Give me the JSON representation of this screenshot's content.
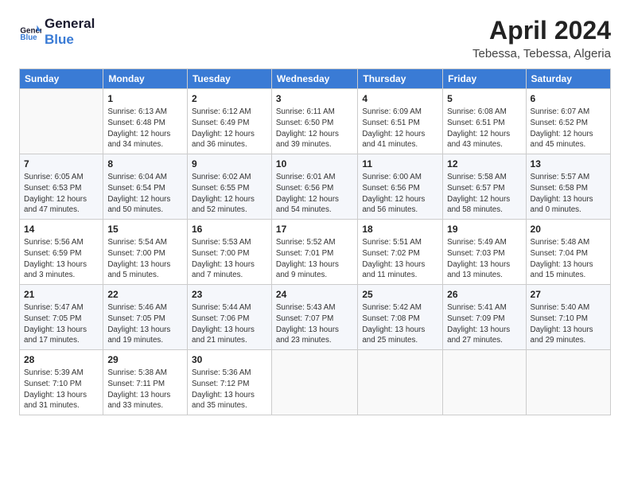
{
  "logo": {
    "line1": "General",
    "line2": "Blue"
  },
  "title": "April 2024",
  "subtitle": "Tebessa, Tebessa, Algeria",
  "days_header": [
    "Sunday",
    "Monday",
    "Tuesday",
    "Wednesday",
    "Thursday",
    "Friday",
    "Saturday"
  ],
  "weeks": [
    [
      {
        "day": "",
        "info": ""
      },
      {
        "day": "1",
        "info": "Sunrise: 6:13 AM\nSunset: 6:48 PM\nDaylight: 12 hours\nand 34 minutes."
      },
      {
        "day": "2",
        "info": "Sunrise: 6:12 AM\nSunset: 6:49 PM\nDaylight: 12 hours\nand 36 minutes."
      },
      {
        "day": "3",
        "info": "Sunrise: 6:11 AM\nSunset: 6:50 PM\nDaylight: 12 hours\nand 39 minutes."
      },
      {
        "day": "4",
        "info": "Sunrise: 6:09 AM\nSunset: 6:51 PM\nDaylight: 12 hours\nand 41 minutes."
      },
      {
        "day": "5",
        "info": "Sunrise: 6:08 AM\nSunset: 6:51 PM\nDaylight: 12 hours\nand 43 minutes."
      },
      {
        "day": "6",
        "info": "Sunrise: 6:07 AM\nSunset: 6:52 PM\nDaylight: 12 hours\nand 45 minutes."
      }
    ],
    [
      {
        "day": "7",
        "info": "Sunrise: 6:05 AM\nSunset: 6:53 PM\nDaylight: 12 hours\nand 47 minutes."
      },
      {
        "day": "8",
        "info": "Sunrise: 6:04 AM\nSunset: 6:54 PM\nDaylight: 12 hours\nand 50 minutes."
      },
      {
        "day": "9",
        "info": "Sunrise: 6:02 AM\nSunset: 6:55 PM\nDaylight: 12 hours\nand 52 minutes."
      },
      {
        "day": "10",
        "info": "Sunrise: 6:01 AM\nSunset: 6:56 PM\nDaylight: 12 hours\nand 54 minutes."
      },
      {
        "day": "11",
        "info": "Sunrise: 6:00 AM\nSunset: 6:56 PM\nDaylight: 12 hours\nand 56 minutes."
      },
      {
        "day": "12",
        "info": "Sunrise: 5:58 AM\nSunset: 6:57 PM\nDaylight: 12 hours\nand 58 minutes."
      },
      {
        "day": "13",
        "info": "Sunrise: 5:57 AM\nSunset: 6:58 PM\nDaylight: 13 hours\nand 0 minutes."
      }
    ],
    [
      {
        "day": "14",
        "info": "Sunrise: 5:56 AM\nSunset: 6:59 PM\nDaylight: 13 hours\nand 3 minutes."
      },
      {
        "day": "15",
        "info": "Sunrise: 5:54 AM\nSunset: 7:00 PM\nDaylight: 13 hours\nand 5 minutes."
      },
      {
        "day": "16",
        "info": "Sunrise: 5:53 AM\nSunset: 7:00 PM\nDaylight: 13 hours\nand 7 minutes."
      },
      {
        "day": "17",
        "info": "Sunrise: 5:52 AM\nSunset: 7:01 PM\nDaylight: 13 hours\nand 9 minutes."
      },
      {
        "day": "18",
        "info": "Sunrise: 5:51 AM\nSunset: 7:02 PM\nDaylight: 13 hours\nand 11 minutes."
      },
      {
        "day": "19",
        "info": "Sunrise: 5:49 AM\nSunset: 7:03 PM\nDaylight: 13 hours\nand 13 minutes."
      },
      {
        "day": "20",
        "info": "Sunrise: 5:48 AM\nSunset: 7:04 PM\nDaylight: 13 hours\nand 15 minutes."
      }
    ],
    [
      {
        "day": "21",
        "info": "Sunrise: 5:47 AM\nSunset: 7:05 PM\nDaylight: 13 hours\nand 17 minutes."
      },
      {
        "day": "22",
        "info": "Sunrise: 5:46 AM\nSunset: 7:05 PM\nDaylight: 13 hours\nand 19 minutes."
      },
      {
        "day": "23",
        "info": "Sunrise: 5:44 AM\nSunset: 7:06 PM\nDaylight: 13 hours\nand 21 minutes."
      },
      {
        "day": "24",
        "info": "Sunrise: 5:43 AM\nSunset: 7:07 PM\nDaylight: 13 hours\nand 23 minutes."
      },
      {
        "day": "25",
        "info": "Sunrise: 5:42 AM\nSunset: 7:08 PM\nDaylight: 13 hours\nand 25 minutes."
      },
      {
        "day": "26",
        "info": "Sunrise: 5:41 AM\nSunset: 7:09 PM\nDaylight: 13 hours\nand 27 minutes."
      },
      {
        "day": "27",
        "info": "Sunrise: 5:40 AM\nSunset: 7:10 PM\nDaylight: 13 hours\nand 29 minutes."
      }
    ],
    [
      {
        "day": "28",
        "info": "Sunrise: 5:39 AM\nSunset: 7:10 PM\nDaylight: 13 hours\nand 31 minutes."
      },
      {
        "day": "29",
        "info": "Sunrise: 5:38 AM\nSunset: 7:11 PM\nDaylight: 13 hours\nand 33 minutes."
      },
      {
        "day": "30",
        "info": "Sunrise: 5:36 AM\nSunset: 7:12 PM\nDaylight: 13 hours\nand 35 minutes."
      },
      {
        "day": "",
        "info": ""
      },
      {
        "day": "",
        "info": ""
      },
      {
        "day": "",
        "info": ""
      },
      {
        "day": "",
        "info": ""
      }
    ]
  ]
}
